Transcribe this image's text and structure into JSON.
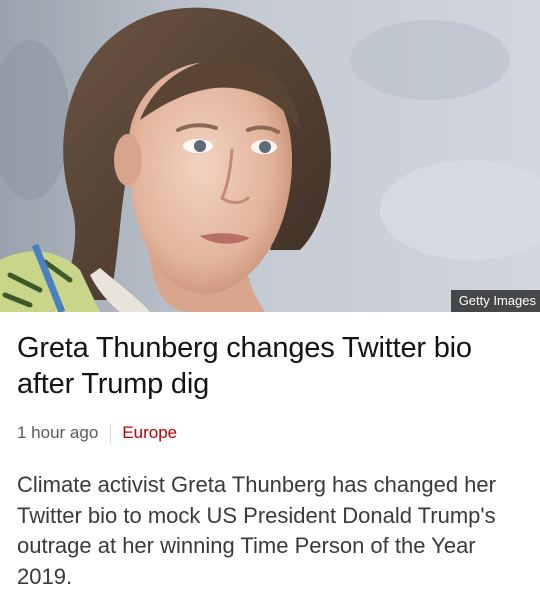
{
  "hero": {
    "image_subject": "portrait-photo",
    "credit": "Getty Images"
  },
  "article": {
    "headline": "Greta Thunberg changes Twitter bio after Trump dig",
    "timestamp": "1 hour ago",
    "category": "Europe",
    "summary": "Climate activist Greta Thunberg has changed her Twitter bio to mock US President Donald Trump's outrage at her winning Time Person of the Year 2019."
  },
  "colors": {
    "category": "#b80000",
    "headline": "#141414",
    "body": "#3a3a3a",
    "credit_bg": "#282828"
  }
}
